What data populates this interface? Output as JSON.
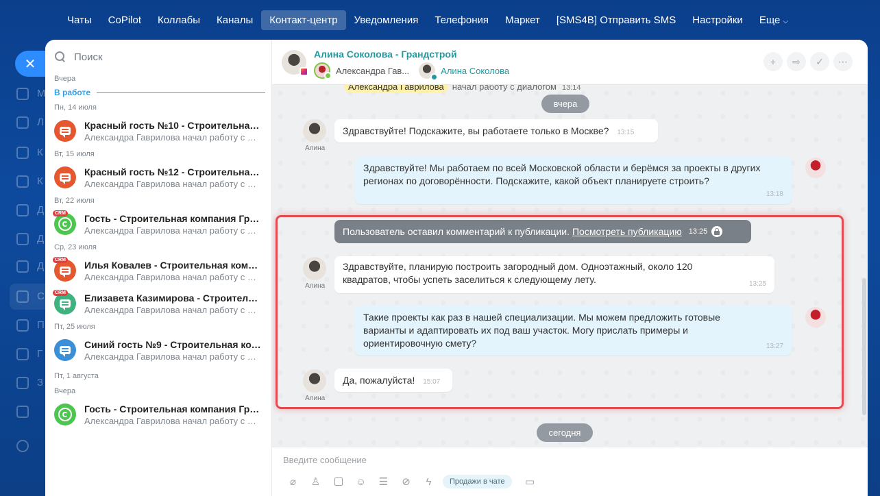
{
  "topnav": {
    "items": [
      "Чаты",
      "CoPilot",
      "Коллабы",
      "Каналы",
      "Контакт-центр",
      "Уведомления",
      "Телефония",
      "Маркет",
      "[SMS4B] Отправить SMS",
      "Настройки",
      "Еще"
    ],
    "active_index": 4
  },
  "portal_sidebar": {
    "close_icon": "✕",
    "letters": [
      "М",
      "Л",
      "К",
      "К",
      "Д",
      "Д",
      "Д",
      "С",
      "П",
      "Г",
      "З"
    ]
  },
  "chatlist": {
    "search_placeholder": "Поиск",
    "top_date": "Вчера",
    "work_label": "В работе",
    "groups": [
      {
        "date": "Пн, 14 июля",
        "title": "Красный гость №10 - Строительная к...",
        "sub": "Александра Гаврилова начал работу с ди...",
        "color": "#e5572e",
        "type": "chat",
        "crm": false
      },
      {
        "date": "Вт, 15 июля",
        "title": "Красный гость №12 - Строительная к...",
        "sub": "Александра Гаврилова начал работу с ди...",
        "color": "#e5572e",
        "type": "chat",
        "crm": false
      },
      {
        "date": "Вт, 22 июля",
        "title": "Гость - Строительная компания Гран...",
        "sub": "Александра Гаврилова начал работу с ди...",
        "color": "#4cc64f",
        "type": "whatsapp",
        "crm": true
      },
      {
        "date": "Ср, 23 июля",
        "title": "Илья Ковалев - Строительная компа...",
        "sub": "Александра Гаврилова начал работу с ди...",
        "color": "#e5572e",
        "type": "chat",
        "crm": true
      },
      {
        "date": "",
        "title": "Елизавета Казимирова - Строительн...",
        "sub": "Александра Гаврилова начал работу с ди...",
        "color": "#3fb27f",
        "type": "chat",
        "crm": true
      },
      {
        "date": "Пт, 25 июля",
        "title": "Синий гость №9 - Строительная ком...",
        "sub": "Александра Гаврилова начал работу с ди...",
        "color": "#3b8fd6",
        "type": "chat",
        "crm": false
      },
      {
        "date": "Пт, 1 августа",
        "title": "",
        "sub": "",
        "color": "",
        "type": "none",
        "crm": false
      },
      {
        "date": "Вчера",
        "title": "Гость - Строительная компания Гран...",
        "sub": "Александра Гаврилова начал работу с ди...",
        "color": "#4cc64f",
        "type": "whatsapp",
        "crm": false
      }
    ],
    "crm_label": "CRM"
  },
  "dialog": {
    "title": "Алина Соколова - Грандстрой",
    "participant1": "Александра Гав...",
    "participant2": "Алина Соколова",
    "actions": [
      "+",
      "⇨",
      "✓",
      "⋯"
    ],
    "system_top": {
      "name": "Александра Гаврилова",
      "text": "начал работу с диалогом",
      "time": "13:14"
    },
    "date_yesterday": "вчера",
    "date_today": "сегодня",
    "sender_label": "Алина",
    "messages": [
      {
        "dir": "in",
        "text": "Здравствуйте! Подскажите, вы работаете только в Москве?",
        "time": "13:15"
      },
      {
        "dir": "out",
        "text": "Здравствуйте! Мы работаем по всей Московской области и берёмся за проекты в других регионах по договорённости. Подскажите, какой объект планируете строить?",
        "time": "13:18"
      },
      {
        "dir": "in",
        "text": "Здравствуйте, планирую построить загородный дом. Одноэтажный, около 120 квадратов, чтобы успеть заселиться к следующему лету.",
        "time": "13:25"
      },
      {
        "dir": "out",
        "text": "Такие проекты как раз в нашей специализации. Мы можем предложить готовые варианты и адаптировать их под ваш участок. Могу прислать примеры и ориентировочную смету?",
        "time": "13:27"
      },
      {
        "dir": "in",
        "text": "Да, пожалуйста!",
        "time": "15:07"
      }
    ],
    "banner": {
      "text": "Пользователь оставил комментарий к публикации.",
      "link": "Посмотреть публикацию",
      "time": "13:25"
    },
    "composer_placeholder": "Введите сообщение",
    "sales_chip": "Продажи в чате"
  }
}
